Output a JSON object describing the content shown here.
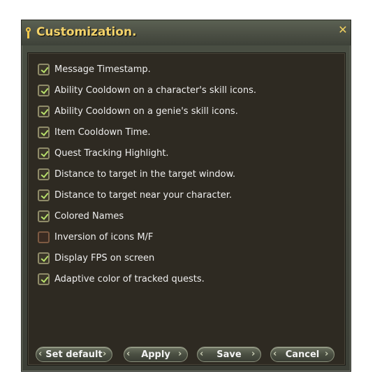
{
  "window": {
    "title": "Customization."
  },
  "options": [
    {
      "label": "Message Timestamp.",
      "checked": true
    },
    {
      "label": "Ability Cooldown on a character's skill icons.",
      "checked": true
    },
    {
      "label": "Ability Cooldown on a genie's skill icons.",
      "checked": true
    },
    {
      "label": "Item Cooldown Time.",
      "checked": true
    },
    {
      "label": "Quest Tracking Highlight.",
      "checked": true
    },
    {
      "label": "Distance to target in the target window.",
      "checked": true
    },
    {
      "label": "Distance to target near your character.",
      "checked": true
    },
    {
      "label": "Colored Names",
      "checked": true
    },
    {
      "label": "Inversion of icons M/F",
      "checked": false
    },
    {
      "label": "Display FPS on screen",
      "checked": true
    },
    {
      "label": "Adaptive color of tracked quests.",
      "checked": true
    }
  ],
  "buttons": {
    "set_default": "Set default",
    "apply": "Apply",
    "save": "Save",
    "cancel": "Cancel"
  },
  "colors": {
    "title": "#f4d36a",
    "checkmark": "#b7e06a",
    "panel": "#2e2a22"
  }
}
